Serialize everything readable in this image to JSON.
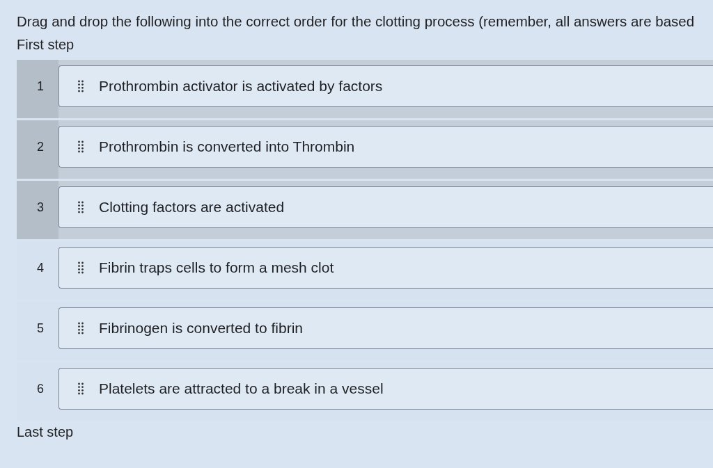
{
  "question": {
    "text": "Drag and drop the following into the correct order for the clotting process (remember, all answers are based"
  },
  "first_label": "First step",
  "items": [
    {
      "number": "1",
      "text": "Prothrombin activator is activated by factors",
      "highlighted": true
    },
    {
      "number": "2",
      "text": "Prothrombin is converted into Thrombin",
      "highlighted": true
    },
    {
      "number": "3",
      "text": "Clotting factors are activated",
      "highlighted": true
    },
    {
      "number": "4",
      "text": "Fibrin traps cells to form a mesh clot",
      "highlighted": false
    },
    {
      "number": "5",
      "text": "Fibrinogen is converted to fibrin",
      "highlighted": false
    },
    {
      "number": "6",
      "text": "Platelets are attracted to a break in a vessel",
      "highlighted": false
    }
  ],
  "last_label": "Last step"
}
